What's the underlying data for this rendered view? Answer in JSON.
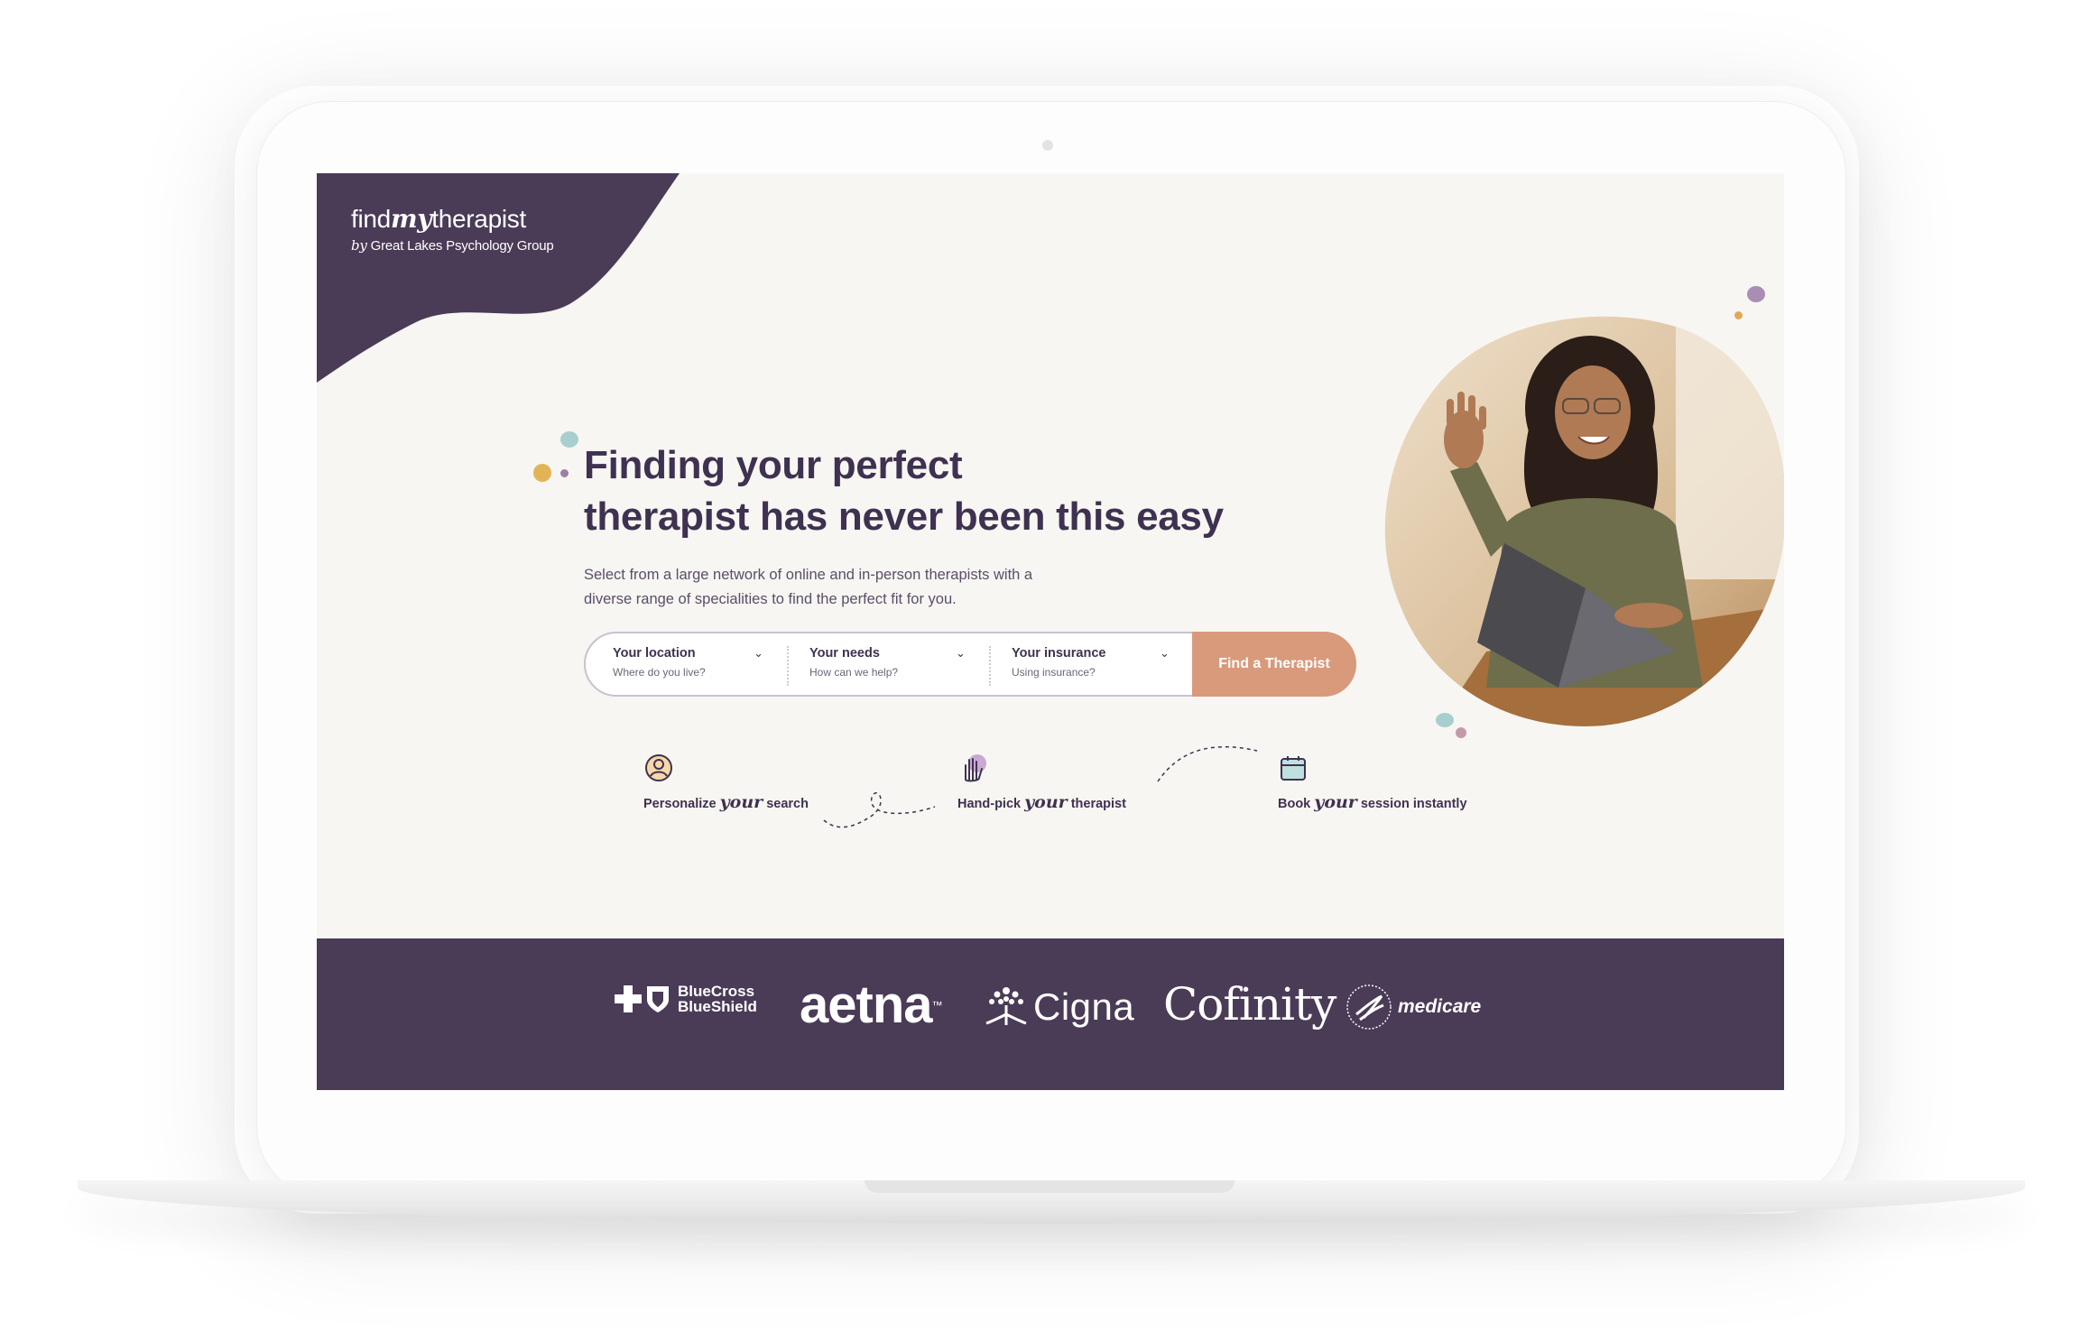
{
  "logo": {
    "find": "find",
    "my": "my",
    "therapist": "therapist",
    "by": "by",
    "org": "Great Lakes Psychology Group"
  },
  "hero": {
    "headline_line1": "Finding your perfect",
    "headline_line2": "therapist has never been this easy",
    "subtext_line1": "Select from a large network of online and in-person therapists with a",
    "subtext_line2": "diverse range of specialities to find the perfect fit for you."
  },
  "search": {
    "location_label": "Your location",
    "location_placeholder": "Where do you live?",
    "needs_label": "Your needs",
    "needs_placeholder": "How can we help?",
    "insurance_label": "Your insurance",
    "insurance_placeholder": "Using insurance?",
    "button_label": "Find a Therapist"
  },
  "features": [
    {
      "icon": "user-circle-icon",
      "before": "Personalize",
      "script": "your",
      "after": "search"
    },
    {
      "icon": "raised-hand-icon",
      "before": "Hand-pick",
      "script": "your",
      "after": "therapist"
    },
    {
      "icon": "calendar-icon",
      "before": "Book",
      "script": "your",
      "after": "session instantly"
    }
  ],
  "insurers": {
    "bcbs_line1": "BlueCross",
    "bcbs_line2": "BlueShield",
    "aetna": "aetna",
    "aetna_tm": "™",
    "cigna": "Cigna",
    "cofinity": "Cofinity",
    "medicare": "medicare"
  },
  "colors": {
    "brand_purple": "#4a3b57",
    "headline": "#3f3151",
    "cta": "#d99a7b",
    "background": "#f8f6f2"
  }
}
